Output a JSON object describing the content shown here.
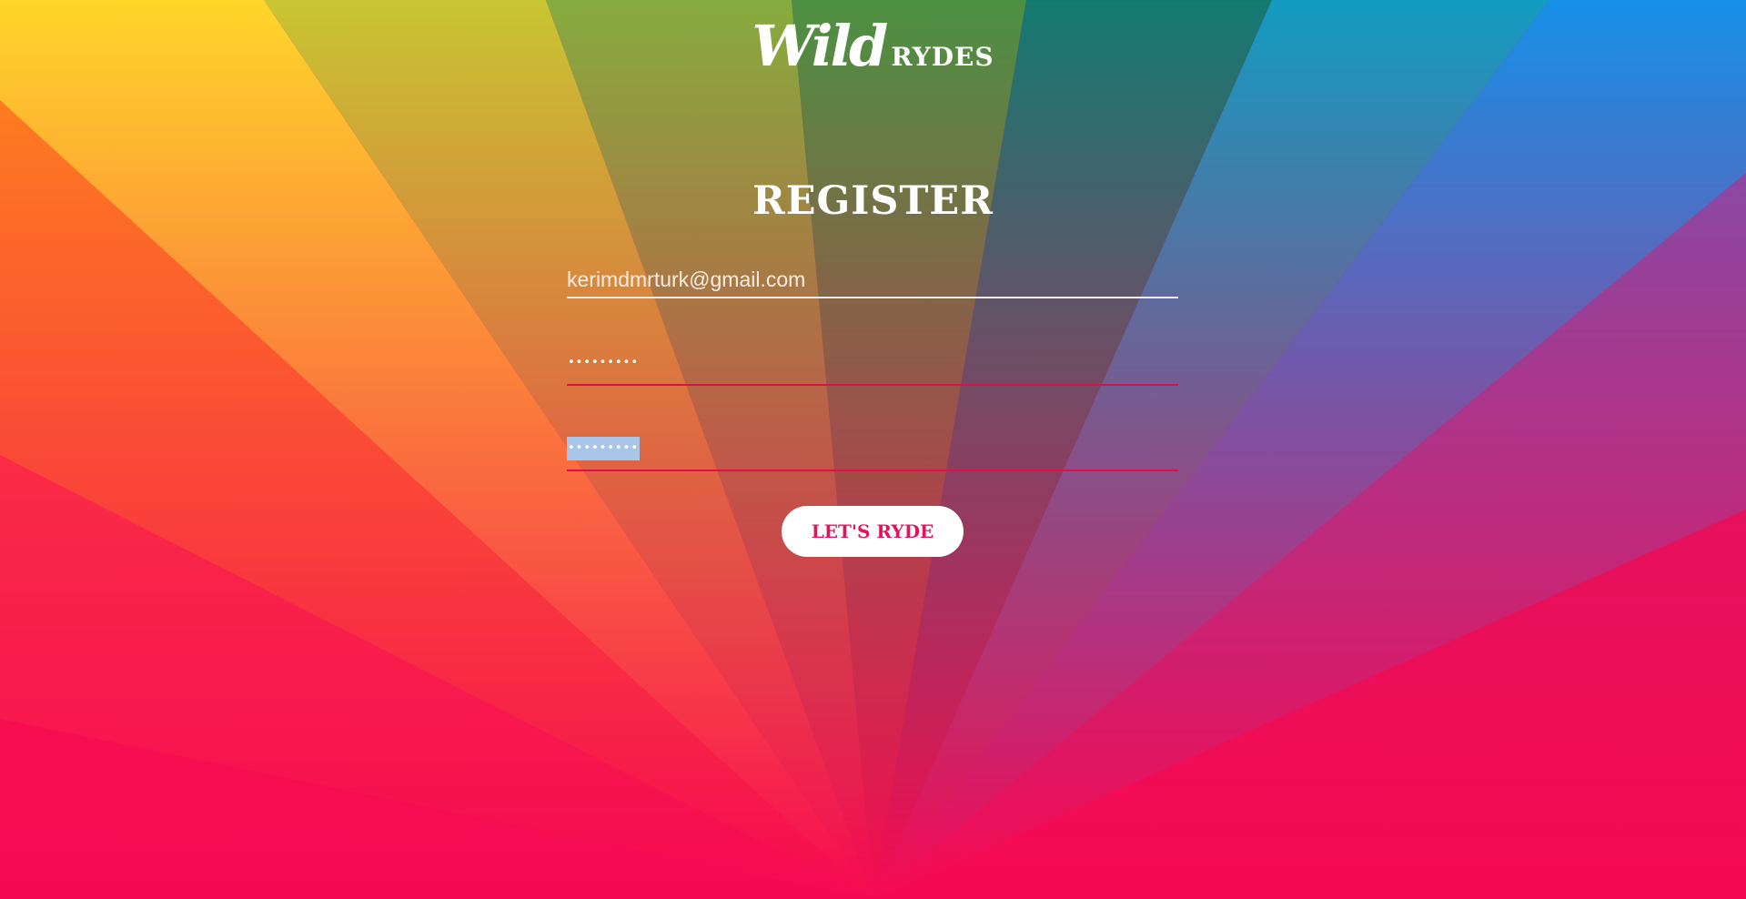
{
  "logo": {
    "wild": "Wild",
    "rydes": "RYDES"
  },
  "form": {
    "title": "REGISTER",
    "email_value": "kerimdmrturk@gmail.com",
    "password_mask": "•••••••••",
    "confirm_password_mask": "•••••••••",
    "submit_label": "LET'S RYDE"
  },
  "colors": {
    "accent": "#e3145d",
    "background_bottom": "#f50a52",
    "selection": "#a9c5e7"
  }
}
